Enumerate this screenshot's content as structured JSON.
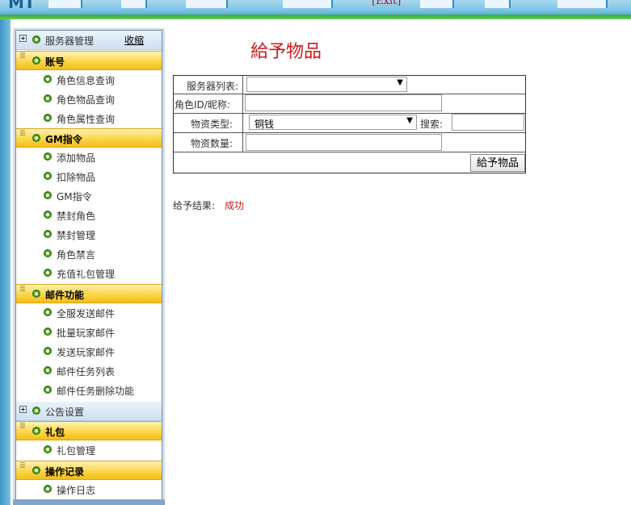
{
  "header": {
    "logo_text": "MT",
    "exit_text": "[Exit]"
  },
  "sidebar": {
    "collapse_label": "收缩",
    "groups": [
      {
        "label": "服务器管理",
        "style": "blue",
        "items": []
      },
      {
        "label": "账号",
        "style": "yellow",
        "items": [
          {
            "label": "角色信息查询"
          },
          {
            "label": "角色物品查询"
          },
          {
            "label": "角色属性查询"
          }
        ]
      },
      {
        "label": "GM指令",
        "style": "yellow",
        "items": [
          {
            "label": "添加物品"
          },
          {
            "label": "扣除物品"
          },
          {
            "label": "GM指令"
          },
          {
            "label": "禁封角色"
          },
          {
            "label": "禁封管理"
          },
          {
            "label": "角色禁言"
          },
          {
            "label": "充值礼包管理"
          }
        ]
      },
      {
        "label": "邮件功能",
        "style": "yellow",
        "items": [
          {
            "label": "全服发送邮件"
          },
          {
            "label": "批量玩家邮件"
          },
          {
            "label": "发送玩家邮件"
          },
          {
            "label": "邮件任务列表"
          },
          {
            "label": "邮件任务删除功能"
          }
        ]
      },
      {
        "label": "公告设置",
        "style": "blue",
        "items": []
      },
      {
        "label": "礼包",
        "style": "yellow",
        "items": [
          {
            "label": "礼包管理"
          }
        ]
      },
      {
        "label": "操作记录",
        "style": "yellow",
        "items": [
          {
            "label": "操作日志"
          }
        ]
      }
    ]
  },
  "main": {
    "title": "給予物品",
    "form": {
      "server_label": "服务器列表:",
      "server_value": "",
      "role_label": "角色ID/昵称:",
      "role_value": "",
      "type_label": "物资类型:",
      "type_value": "铜钱",
      "search_label": "搜索:",
      "search_value": "",
      "qty_label": "物资数量:",
      "qty_value": "",
      "submit_label": "給予物品"
    },
    "result_label": "给予结果:",
    "result_value": "成功"
  },
  "colors": {
    "title": "#cc1b1b",
    "result": "#cc1b1b",
    "group_yellow": "#fcd54a",
    "banner_green": "#39a845"
  },
  "icons": {
    "group_expand": "plus-box-icon",
    "bullet": "green-circle-icon"
  }
}
